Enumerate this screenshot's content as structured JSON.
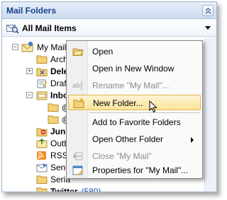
{
  "header": {
    "title": "Mail Folders"
  },
  "all_mail": {
    "label": "All Mail Items"
  },
  "tree": {
    "root": {
      "label": "My Mail"
    },
    "items": [
      {
        "label": "Archi",
        "bold": false,
        "count": ""
      },
      {
        "label": "Delet",
        "bold": true,
        "count": ""
      },
      {
        "label": "Draft",
        "bold": false,
        "count": ""
      },
      {
        "label": "Inbox",
        "bold": true,
        "count": ""
      },
      {
        "label": "@",
        "bold": false,
        "count": ""
      },
      {
        "label": "@",
        "bold": false,
        "count": ""
      },
      {
        "label": "Junk",
        "bold": true,
        "count": ""
      },
      {
        "label": "Outb",
        "bold": false,
        "count": ""
      },
      {
        "label": "RSS F",
        "bold": false,
        "count": ""
      },
      {
        "label": "Sent",
        "bold": false,
        "count": ""
      },
      {
        "label": "Seria",
        "bold": false,
        "count": ""
      },
      {
        "label": "Twitter",
        "bold": true,
        "count": "(580)"
      }
    ]
  },
  "context_menu": {
    "open": "Open",
    "open_new_window": "Open in New Window",
    "rename": "Rename \"My Mail\"...",
    "new_folder": "New Folder...",
    "add_favorite": "Add to Favorite Folders",
    "open_other": "Open Other Folder",
    "close": "Close \"My Mail\"",
    "properties": "Properties for \"My Mail\"..."
  },
  "colors": {
    "header_text": "#15428b",
    "highlight": "#fce49c",
    "count_text": "#1a4bb5"
  }
}
